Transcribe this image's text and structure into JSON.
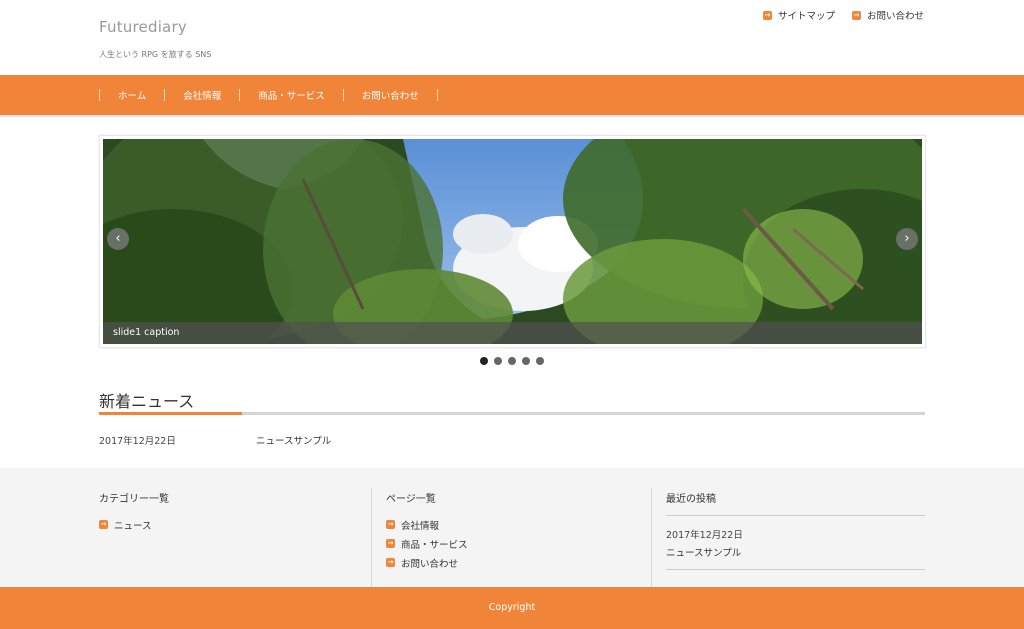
{
  "site": {
    "title": "Futurediary",
    "description": "人生という RPG を旅する SNS"
  },
  "util_nav": [
    "サイトマップ",
    "お問い合わせ"
  ],
  "global_nav": [
    "ホーム",
    "会社情報",
    "商品・サービス",
    "お問い合わせ"
  ],
  "slider": {
    "caption": "slide1 caption",
    "slide_count": 5,
    "active_index": 0,
    "prev_icon": "chevron-left-icon",
    "next_icon": "chevron-right-icon"
  },
  "news": {
    "heading": "新着ニュース",
    "items": [
      {
        "date": "2017年12月22日",
        "title": "ニュースサンプル"
      }
    ]
  },
  "footer": {
    "category": {
      "heading": "カテゴリー一覧",
      "items": [
        "ニュース"
      ]
    },
    "pages": {
      "heading": "ページ一覧",
      "items": [
        "会社情報",
        "商品・サービス",
        "お問い合わせ"
      ]
    },
    "recent": {
      "heading": "最近の投稿",
      "items": [
        {
          "date": "2017年12月22日",
          "title": "ニュースサンプル"
        }
      ]
    },
    "copyright": "Copyright"
  },
  "colors": {
    "accent": "#f0853a",
    "footer_bg": "#f4f4f4"
  }
}
